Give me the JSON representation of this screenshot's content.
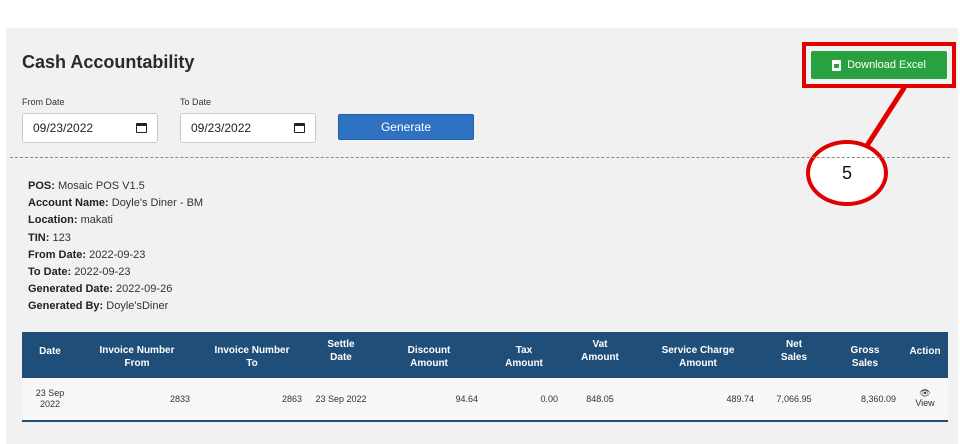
{
  "page": {
    "title": "Cash Accountability"
  },
  "filters": {
    "from_label": "From Date",
    "from_value": "09/23/2022",
    "to_label": "To Date",
    "to_value": "09/23/2022",
    "generate_label": "Generate"
  },
  "toolbar": {
    "download_label": "Download Excel"
  },
  "callout": {
    "number": "5"
  },
  "info": [
    {
      "label": "POS:",
      "value": "Mosaic POS V1.5"
    },
    {
      "label": "Account Name:",
      "value": "Doyle's Diner - BM"
    },
    {
      "label": "Location:",
      "value": "makati"
    },
    {
      "label": "TIN:",
      "value": "123"
    },
    {
      "label": "From Date:",
      "value": "2022-09-23"
    },
    {
      "label": "To Date:",
      "value": "2022-09-23"
    },
    {
      "label": "Generated Date:",
      "value": "2022-09-26"
    },
    {
      "label": "Generated By:",
      "value": "Doyle'sDiner"
    }
  ],
  "table": {
    "headers": [
      [
        "Date"
      ],
      [
        "Invoice Number",
        "From"
      ],
      [
        "Invoice Number",
        "To"
      ],
      [
        "Settle",
        "Date"
      ],
      [
        "Discount",
        "Amount"
      ],
      [
        "Tax",
        "Amount"
      ],
      [
        "Vat",
        "Amount"
      ],
      [
        "Service Charge",
        "Amount"
      ],
      [
        "Net",
        "Sales"
      ],
      [
        "Gross",
        "Sales"
      ],
      [
        "Action"
      ]
    ],
    "rows": [
      {
        "date": "23 Sep 2022",
        "invoice_from": "2833",
        "invoice_to": "2863",
        "settle_date": "23 Sep 2022",
        "discount": "94.64",
        "tax": "0.00",
        "vat": "848.05",
        "service_charge": "489.74",
        "net_sales": "7,066.95",
        "gross_sales": "8,360.09",
        "action": "View"
      }
    ]
  }
}
